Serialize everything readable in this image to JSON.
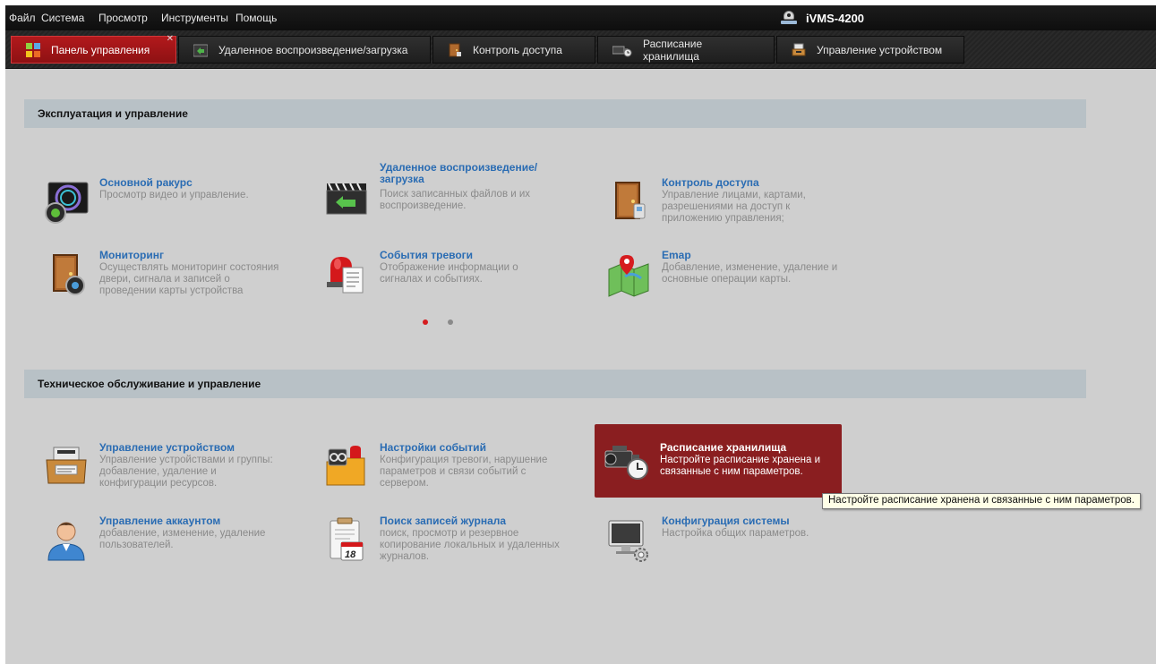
{
  "menu": [
    "Файл",
    "Система",
    "Просмотр",
    "Инструменты",
    "Помощь"
  ],
  "app_title": "iVMS-4200",
  "tabs": [
    {
      "label": "Панель управления",
      "icon": "grid-icon",
      "active": true
    },
    {
      "label": "Удаленное воспроизведение/загрузка",
      "icon": "playback-icon",
      "active": false
    },
    {
      "label": "Контроль доступа",
      "icon": "door-icon",
      "active": false
    },
    {
      "label": "Расписание хранилища",
      "icon": "camera-clock-icon",
      "active": false
    },
    {
      "label": "Управление устройством",
      "icon": "device-icon",
      "active": false
    }
  ],
  "sections": [
    {
      "title": "Эксплуатация и управление",
      "items": [
        {
          "title": "Основной ракурс",
          "desc": "Просмотр видео и управление.",
          "icon": "live-view-icon"
        },
        {
          "title": "Удаленное воспроизведение/ загрузка",
          "desc": "Поиск записанных файлов и их воспроизведение.",
          "icon": "remote-playback-icon"
        },
        {
          "title": "Контроль доступа",
          "desc": "Управление лицами, картами, разрешениями на доступ к приложению управления;",
          "icon": "access-control-icon"
        },
        {
          "title": "Мониторинг",
          "desc": "Осуществлять мониторинг состояния двери, сигнала и записей о проведении карты устройства",
          "icon": "door-monitoring-icon"
        },
        {
          "title": "События тревоги",
          "desc": "Отображение информации о сигналах и событиях.",
          "icon": "alarm-event-icon"
        },
        {
          "title": "Emap",
          "desc": "Добавление, изменение, удаление и основные операции карты.",
          "icon": "map-icon"
        }
      ]
    },
    {
      "title": "Техническое обслуживание и управление",
      "items": [
        {
          "title": "Управление устройством",
          "desc": "Управление устройствами и группы: добавление, удаление и конфигурации ресурсов.",
          "icon": "device-management-icon"
        },
        {
          "title": "Настройки событий",
          "desc": "Конфигурация тревоги, нарушение параметров и связи событий с сервером.",
          "icon": "event-settings-icon"
        },
        {
          "title": "Расписание хранилища",
          "desc": "Настройте расписание хранена и связанные с ним параметров.",
          "icon": "storage-schedule-icon"
        },
        {
          "title": "Управление аккаунтом",
          "desc": "добавление, изменение, удаление пользователей.",
          "icon": "account-icon"
        },
        {
          "title": "Поиск записей журнала",
          "desc": "поиск, просмотр и резервное копирование локальных и удаленных журналов.",
          "icon": "log-search-icon"
        },
        {
          "title": "Конфигурация системы",
          "desc": "Настройка общих параметров.",
          "icon": "system-config-icon"
        }
      ]
    }
  ],
  "calendar_day": "18",
  "pager": {
    "pages": 2,
    "current": 1
  },
  "tooltip": "Настройте расписание хранена и связанные с ним параметров.",
  "colors": {
    "accent": "#b2191c",
    "link": "#2a6cb3",
    "highlight": "#8a1e20"
  }
}
